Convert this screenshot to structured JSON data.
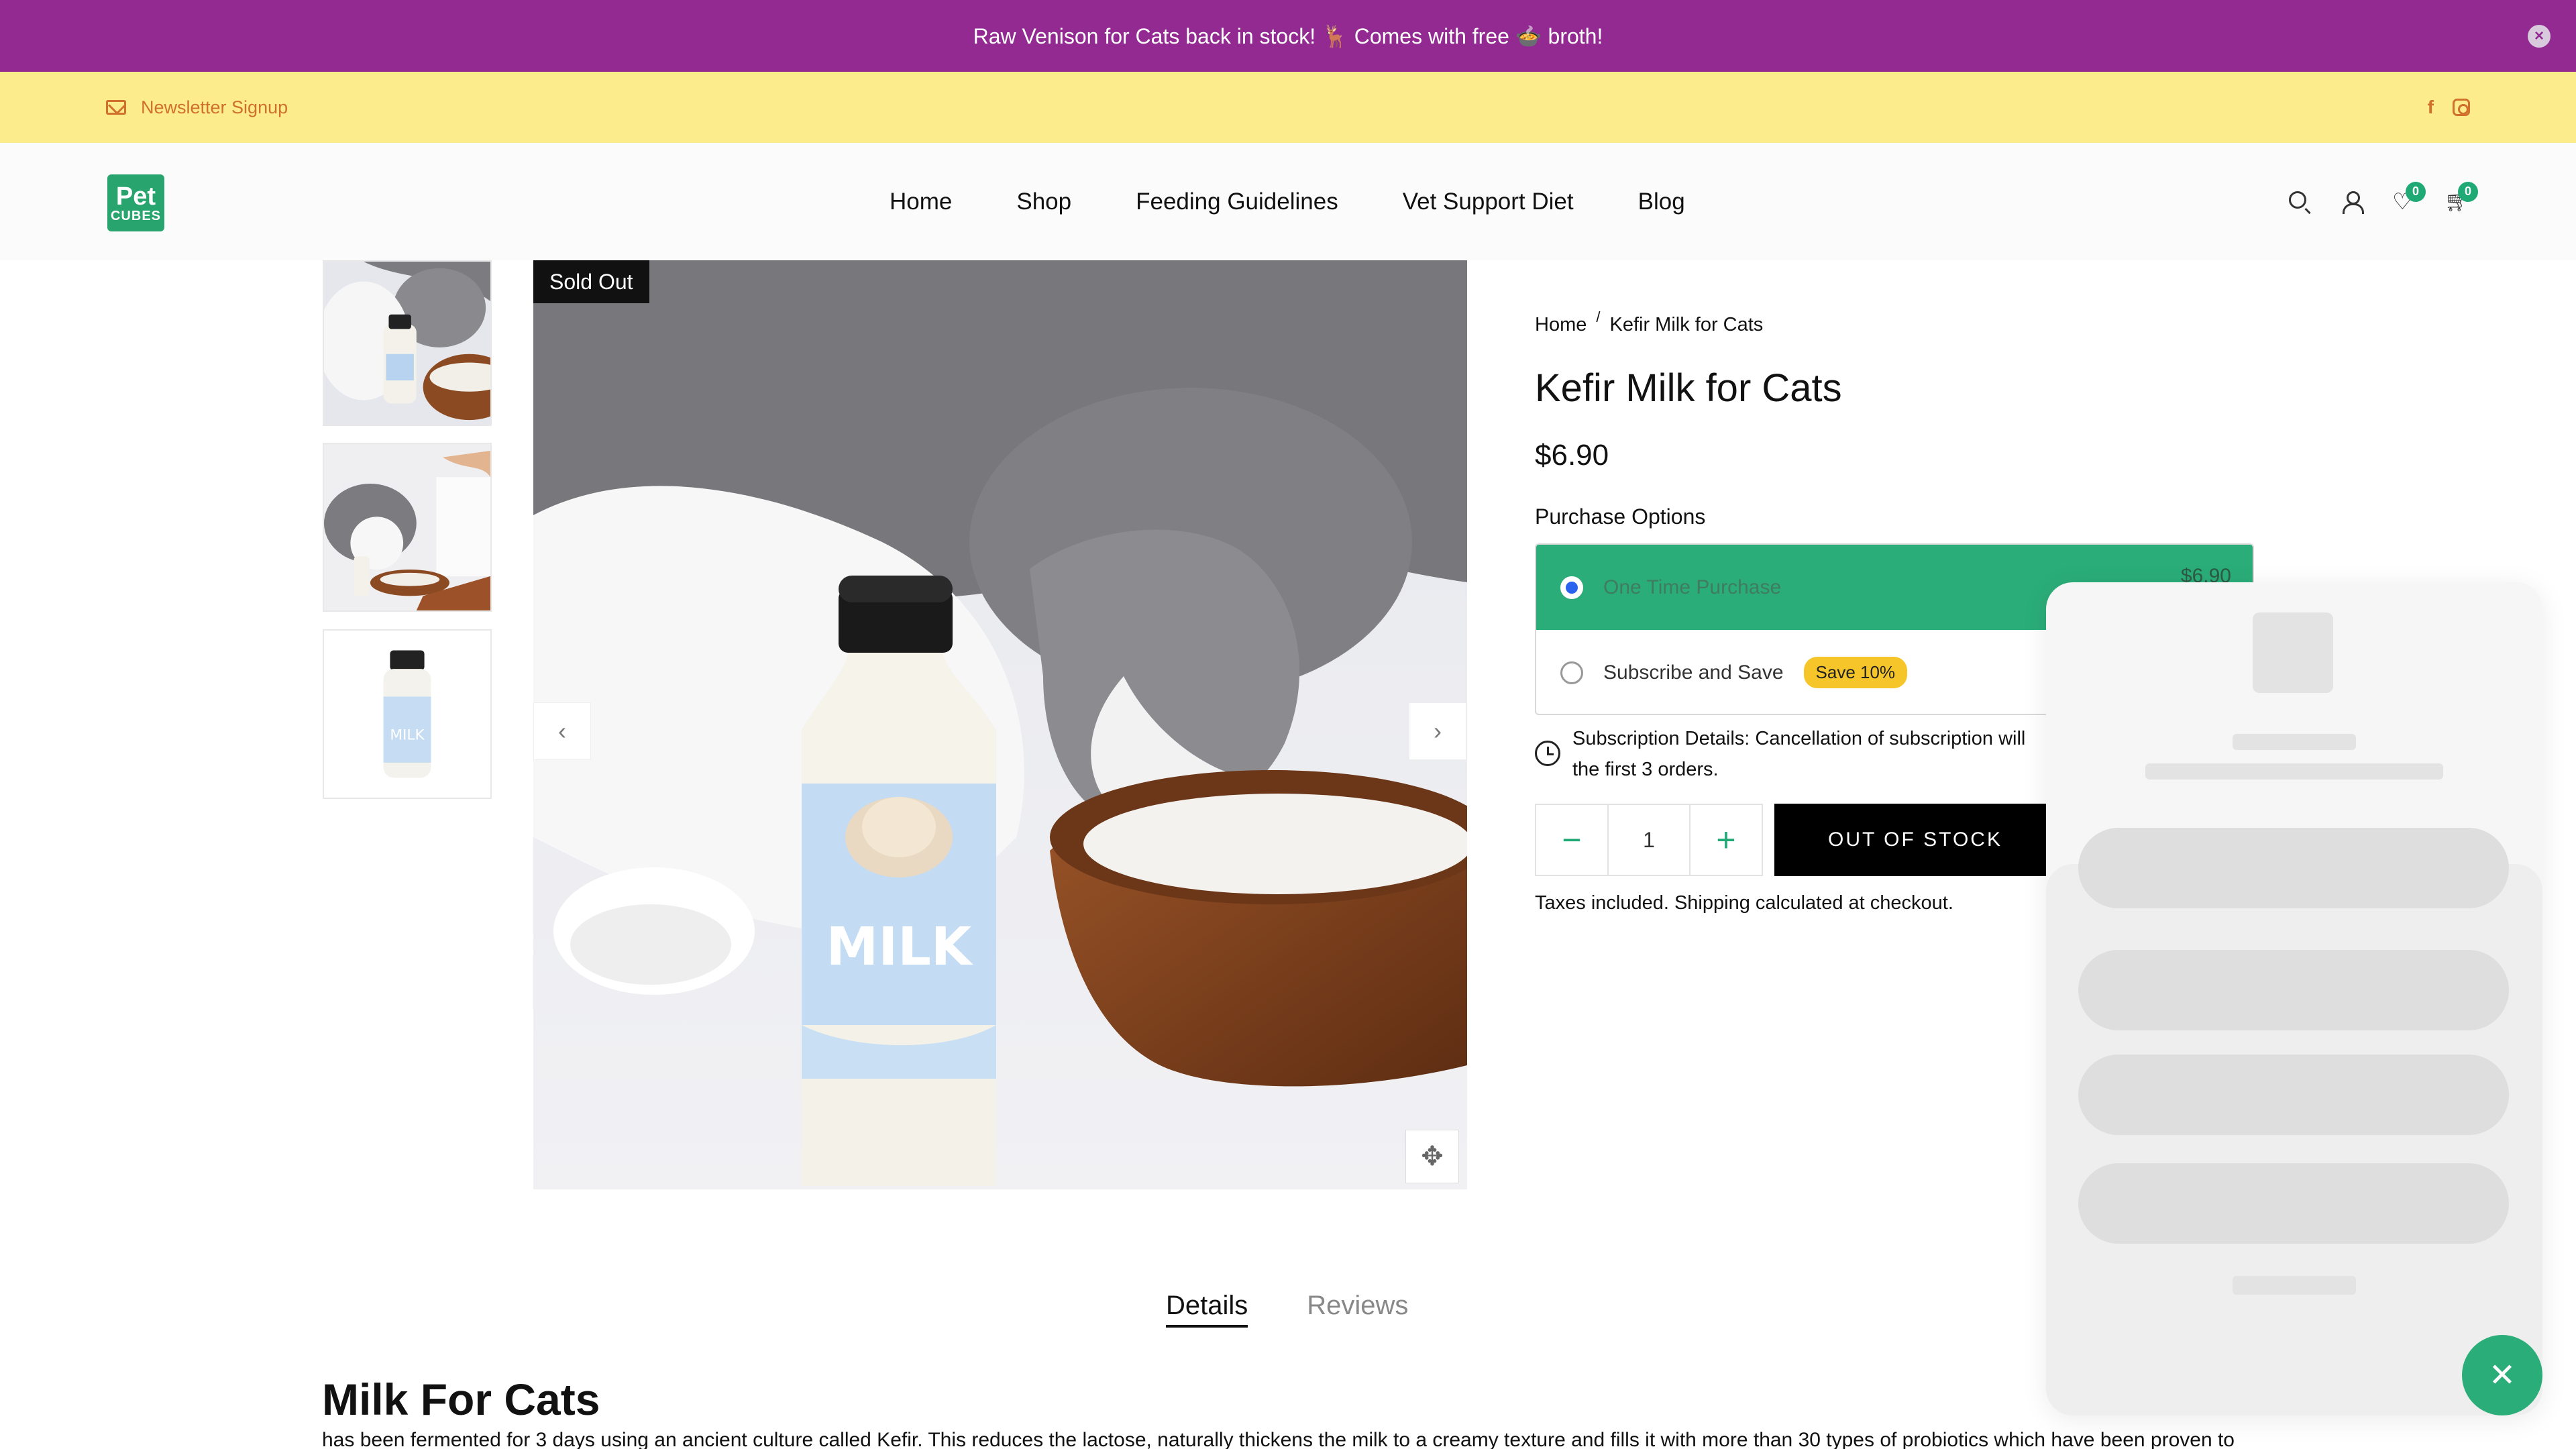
{
  "announcement": {
    "text": "Raw Venison for Cats back in stock! 🦌  Comes with free 🍲 broth!",
    "close_icon": "close-icon"
  },
  "topbar": {
    "newsletter_label": "Newsletter Signup",
    "facebook_glyph": "f"
  },
  "header": {
    "logo_line1": "Pet",
    "logo_line2": "CUBES",
    "nav": [
      "Home",
      "Shop",
      "Feeding Guidelines",
      "Vet Support Diet",
      "Blog"
    ],
    "wishlist_count": "0",
    "cart_count": "0"
  },
  "gallery": {
    "sold_out_label": "Sold Out",
    "bottle_label": "MILK",
    "prev_glyph": "‹",
    "next_glyph": "›"
  },
  "product": {
    "breadcrumb": [
      "Home",
      "Kefir Milk for Cats"
    ],
    "breadcrumb_sep": "/",
    "title": "Kefir Milk for Cats",
    "price": "$6.90",
    "purchase_options_label": "Purchase Options",
    "options": [
      {
        "label": "One Time Purchase",
        "price": "$6.90",
        "selected": true
      },
      {
        "label": "Subscribe and Save",
        "badge": "Save 10%",
        "selected": false
      }
    ],
    "subscription_details": "Subscription Details: Cancellation of subscription will be available after the first 3 orders.",
    "subscription_details_visible_line1": "Subscription Details: Cancellation of subscription will",
    "subscription_details_visible_line2": "the first 3 orders.",
    "quantity": "1",
    "minus_glyph": "−",
    "plus_glyph": "+",
    "cta": "OUT OF STOCK",
    "taxes": "Taxes included. Shipping calculated at checkout."
  },
  "tabs": {
    "items": [
      "Details",
      "Reviews"
    ],
    "active": "Details"
  },
  "description": {
    "title": "Milk For Cats",
    "text": "has been fermented for 3 days using an ancient culture called Kefir. This reduces the lactose, naturally thickens the milk to a creamy texture and fills it with more than 30 types of probiotics which have been proven to"
  },
  "chat_widget": {
    "close_glyph": "✕"
  },
  "colors": {
    "announcement_bg": "#922a91",
    "topbar_bg": "#fcec8c",
    "accent_green": "#2aad78",
    "badge_yellow": "#f6c52a"
  }
}
